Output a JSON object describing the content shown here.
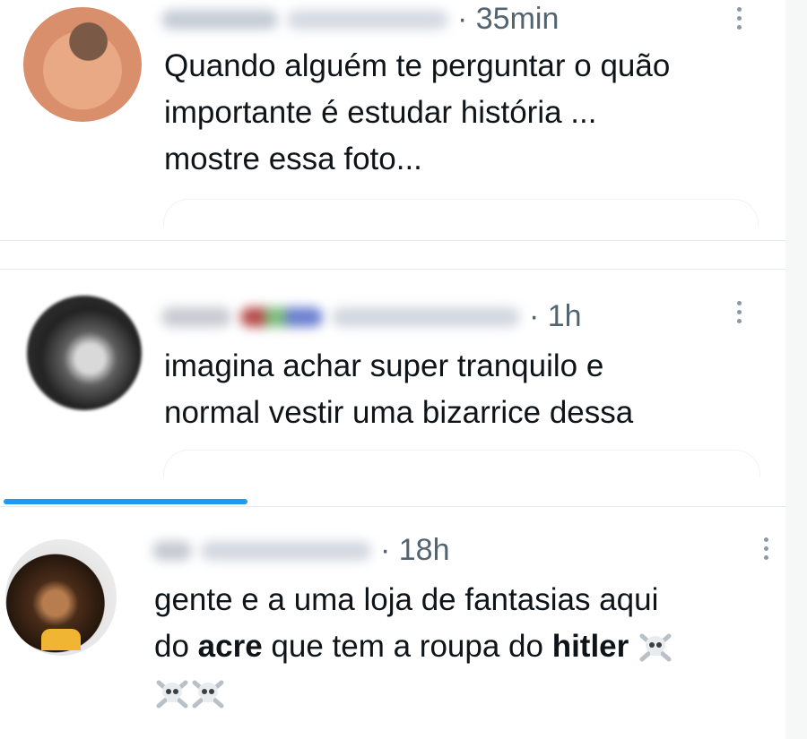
{
  "tweets": [
    {
      "time": "· 35min",
      "lines": [
        "Quando alguém te perguntar o quão",
        "importante é estudar história ...",
        "mostre essa foto..."
      ]
    },
    {
      "time": "· 1h",
      "lines": [
        "imagina achar super tranquilo e",
        "normal vestir uma bizarrice dessa"
      ]
    },
    {
      "time": "· 18h",
      "line1": "gente e a uma loja de fantasias aqui",
      "line2_before": "do ",
      "bold1": "acre",
      "line2_mid": " que tem a roupa do ",
      "bold2": "hitler",
      "emoji_name": "skull-and-crossbones-icon"
    }
  ],
  "icons": {
    "more": "more-options-icon",
    "emoji": "skull-and-crossbones-icon"
  },
  "colors": {
    "text": "#0f1419",
    "secondary": "#536471",
    "accent": "#1d9bf0",
    "divider": "#e6e9ea"
  }
}
